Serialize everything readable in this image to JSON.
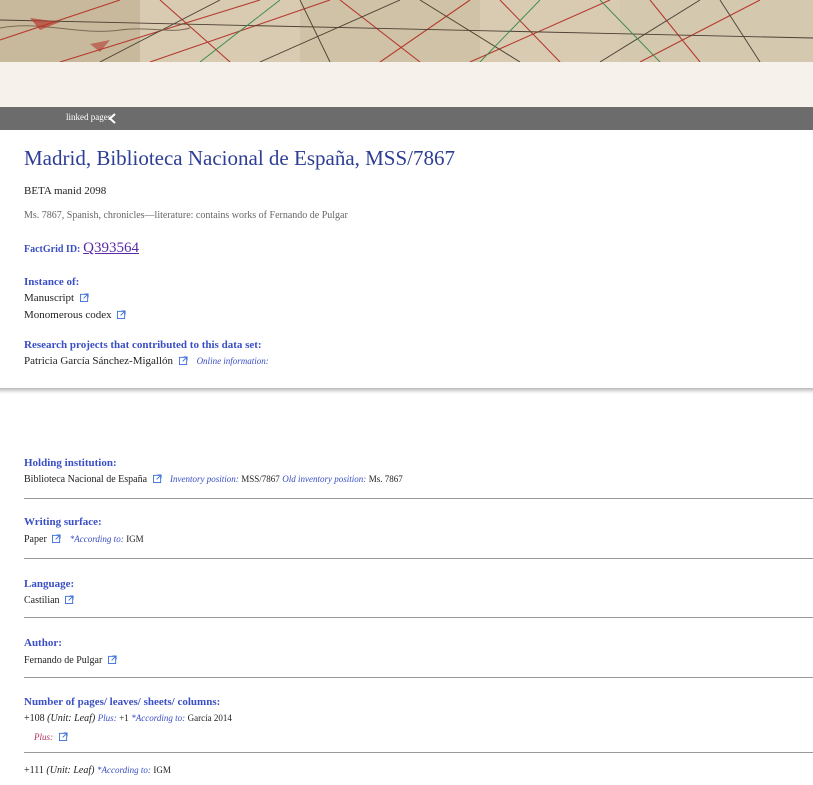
{
  "linkbar": {
    "label": "linked pages"
  },
  "header": {
    "title": "Madrid, Biblioteca Nacional de España, MSS/7867",
    "beta_id": "BETA manid 2098",
    "description": "Ms. 7867, Spanish, chronicles—literature: contains works of Fernando de Pulgar",
    "factgrid_label": "FactGrid ID:",
    "factgrid_id": "Q393564"
  },
  "instance_of": {
    "label": "Instance of:",
    "items": [
      "Manuscript",
      "Monomerous codex"
    ]
  },
  "research": {
    "label": "Research projects that contributed to this data set:",
    "person": "Patricia García Sánchez-Migallón",
    "online_label": "Online information:"
  },
  "holding": {
    "label": "Holding institution:",
    "value": "Biblioteca Nacional de España",
    "inv_label": "Inventory position:",
    "inv_value": "MSS/7867",
    "old_label": "Old inventory position:",
    "old_value": "Ms. 7867"
  },
  "surface": {
    "label": "Writing surface:",
    "value": "Paper",
    "according_label": "*According to:",
    "according_value": "IGM"
  },
  "language": {
    "label": "Language:",
    "value": "Castilian"
  },
  "author": {
    "label": "Author:",
    "value": "Fernando de Pulgar"
  },
  "pages": {
    "label": "Number of pages/ leaves/ sheets/ columns:",
    "row1": {
      "value": "+108",
      "unit": "(Unit: Leaf)",
      "plus_label": "Plus:",
      "plus_value": "+1",
      "according_label": "*According to:",
      "according_value": "García 2014"
    },
    "row1_plus_label": "Plus:",
    "row2": {
      "value": "+111",
      "unit": "(Unit: Leaf)",
      "according_label": "*According to:",
      "according_value": "IGM"
    }
  },
  "colors": {
    "title": "#2d3e94",
    "label": "#3a4fc4",
    "link": "#5a2aa6",
    "bar": "#6c6c6c",
    "plus": "#b0305a"
  }
}
